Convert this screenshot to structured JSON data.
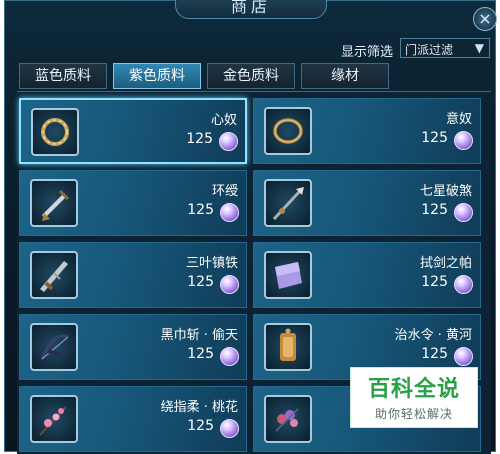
{
  "window": {
    "title": "商店",
    "close_label": "×"
  },
  "filter": {
    "label": "显示筛选",
    "selected": "门派过滤",
    "arrow": "▼"
  },
  "tabs": [
    {
      "label": "蓝色质料",
      "active": false
    },
    {
      "label": "紫色质料",
      "active": true
    },
    {
      "label": "金色质料",
      "active": false
    },
    {
      "label": "缘材",
      "active": false
    }
  ],
  "currency_icon": "purple-gem-icon",
  "items": [
    {
      "name": "心奴",
      "price": "125",
      "icon": "bracelet-icon",
      "selected": true
    },
    {
      "name": "意奴",
      "price": "125",
      "icon": "ring-icon",
      "selected": false
    },
    {
      "name": "环绶",
      "price": "125",
      "icon": "dagger-icon",
      "selected": false
    },
    {
      "name": "七星破煞",
      "price": "125",
      "icon": "spear-icon",
      "selected": false
    },
    {
      "name": "三叶镇铁",
      "price": "125",
      "icon": "blade-icon",
      "selected": false
    },
    {
      "name": "拭剑之帕",
      "price": "125",
      "icon": "cloth-icon",
      "selected": false
    },
    {
      "name": "黑巾斩 · 偷天",
      "price": "125",
      "icon": "bow-icon",
      "selected": false
    },
    {
      "name": "治水令 · 黄河",
      "price": "125",
      "icon": "token-icon",
      "selected": false
    },
    {
      "name": "绕指柔 · 桃花",
      "price": "125",
      "icon": "flower-branch-icon",
      "selected": false
    },
    {
      "name": "",
      "price": "",
      "icon": "flower-cluster-icon",
      "selected": false
    }
  ],
  "watermark": {
    "title": "百科全说",
    "subtitle": "助你轻松解决"
  }
}
